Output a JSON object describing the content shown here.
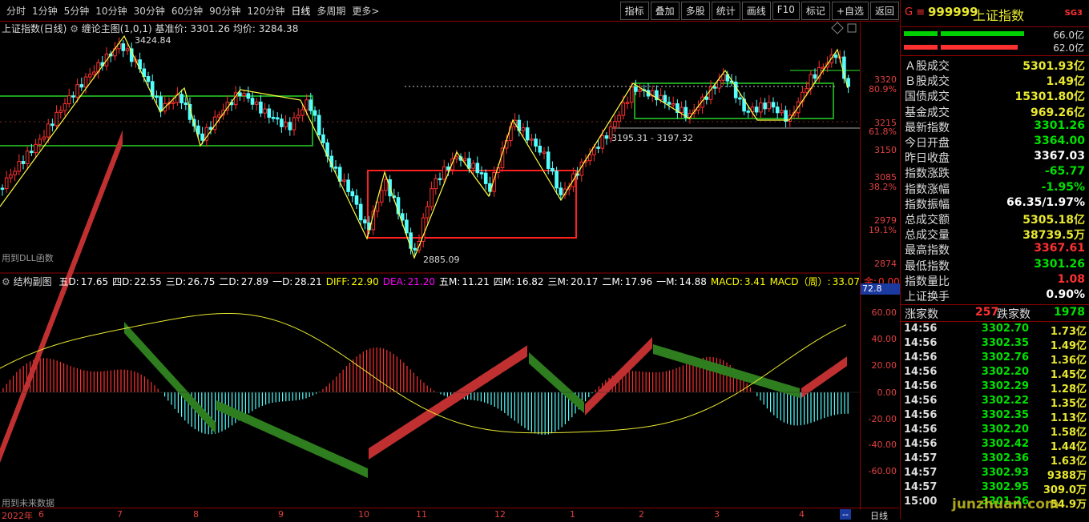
{
  "toolbar": {
    "periods": [
      "分时",
      "1分钟",
      "5分钟",
      "10分钟",
      "30分钟",
      "60分钟",
      "90分钟",
      "120分钟",
      "日线",
      "多周期",
      "更多>"
    ],
    "active_period": "日线",
    "tools": [
      "指标",
      "叠加",
      "多股",
      "统计",
      "画线",
      "F10",
      "标记",
      "+自选",
      "返回"
    ]
  },
  "main_chart": {
    "title": "上证指数(日线)",
    "indicator": "缠论主图(1,0,1)",
    "base_price_label": "基准价: 3301.26",
    "avg_price_label": "均价: 3284.38",
    "high_label": "3424.84",
    "low_label": "2885.09",
    "range_label": "3195.31 - 3197.32",
    "footnote": "用到DLL函数",
    "price_ticks": [
      "3320",
      "3215",
      "3150",
      "3085",
      "2979",
      "2874"
    ],
    "pct_ticks": [
      "80.9%",
      "61.8%",
      "38.2%",
      "19.1%"
    ]
  },
  "sub_chart": {
    "title": "结构副图",
    "values": [
      {
        "label": "五D:",
        "value": "17.65",
        "color": "#ffffff"
      },
      {
        "label": "四D:",
        "value": "22.55",
        "color": "#ffffff"
      },
      {
        "label": "三D:",
        "value": "26.75",
        "color": "#ffffff"
      },
      {
        "label": "二D:",
        "value": "27.89",
        "color": "#ffffff"
      },
      {
        "label": "一D:",
        "value": "28.21",
        "color": "#ffffff"
      },
      {
        "label": "DIFF:",
        "value": "22.90",
        "color": "#ffff00"
      },
      {
        "label": "DEA:",
        "value": "21.20",
        "color": "#ff00ff"
      },
      {
        "label": "五M:",
        "value": "11.21",
        "color": "#ffffff"
      },
      {
        "label": "四M:",
        "value": "16.82",
        "color": "#ffffff"
      },
      {
        "label": "三M:",
        "value": "20.17",
        "color": "#ffffff"
      },
      {
        "label": "二M:",
        "value": "17.96",
        "color": "#ffffff"
      },
      {
        "label": "一M:",
        "value": "14.88",
        "color": "#ffffff"
      },
      {
        "label": "MACD:",
        "value": "3.41",
        "color": "#ffff00"
      },
      {
        "label": "MACD（周）:",
        "value": "33.07",
        "color": "#ffff00"
      },
      {
        "label": "金:",
        "value": "0.00",
        "color": "#ff3030"
      },
      {
        "label": "木",
        "value": "",
        "color": "#00ff00"
      }
    ],
    "ticks": [
      "60.00",
      "40.00",
      "20.00",
      "0.00",
      "-20.00",
      "-40.00",
      "-60.00"
    ],
    "marker_value": "72.8",
    "footnote": "用到未来数据"
  },
  "x_axis": {
    "labels": [
      "2022年",
      "6",
      "7",
      "8",
      "9",
      "10",
      "11",
      "12",
      "1",
      "2",
      "3",
      "4"
    ],
    "period_label": "日线"
  },
  "quote_panel": {
    "code_prefix": "G ≡",
    "code": "999999",
    "name": "上证指数",
    "badge": "SG3",
    "bar_values": [
      "66.0亿",
      "62.0亿"
    ],
    "stats": [
      {
        "k": "Ａ股成交",
        "v": "5301.93亿",
        "color": "#e8e830"
      },
      {
        "k": "Ｂ股成交",
        "v": "1.49亿",
        "color": "#e8e830"
      },
      {
        "k": "国债成交",
        "v": "15301.80亿",
        "color": "#e8e830"
      },
      {
        "k": "基金成交",
        "v": "969.26亿",
        "color": "#e8e830"
      },
      {
        "k": "最新指数",
        "v": "3301.26",
        "color": "#00e000"
      },
      {
        "k": "今日开盘",
        "v": "3364.00",
        "color": "#00e000"
      },
      {
        "k": "昨日收盘",
        "v": "3367.03",
        "color": "#ffffff"
      },
      {
        "k": "指数涨跌",
        "v": "-65.77",
        "color": "#00e000"
      },
      {
        "k": "指数涨幅",
        "v": "-1.95%",
        "color": "#00e000"
      },
      {
        "k": "指数振幅",
        "v": "66.35/1.97%",
        "color": "#ffffff"
      },
      {
        "k": "总成交额",
        "v": "5305.18亿",
        "color": "#e8e830"
      },
      {
        "k": "总成交量",
        "v": "38739.5万",
        "color": "#e8e830"
      },
      {
        "k": "最高指数",
        "v": "3367.61",
        "color": "#ff3030"
      },
      {
        "k": "最低指数",
        "v": "3301.26",
        "color": "#00e000"
      },
      {
        "k": "指数量比",
        "v": "1.08",
        "color": "#ff3030"
      },
      {
        "k": "上证换手",
        "v": "0.90%",
        "color": "#ffffff"
      }
    ],
    "up_label": "涨家数",
    "up_count": "257",
    "down_label": "跌家数",
    "down_count": "1978",
    "ticks": [
      {
        "t": "14:56",
        "p": "3302.70",
        "v": "1.73亿"
      },
      {
        "t": "14:56",
        "p": "3302.35",
        "v": "1.49亿"
      },
      {
        "t": "14:56",
        "p": "3302.76",
        "v": "1.36亿"
      },
      {
        "t": "14:56",
        "p": "3302.20",
        "v": "1.45亿"
      },
      {
        "t": "14:56",
        "p": "3302.29",
        "v": "1.28亿"
      },
      {
        "t": "14:56",
        "p": "3302.22",
        "v": "1.35亿"
      },
      {
        "t": "14:56",
        "p": "3302.35",
        "v": "1.13亿"
      },
      {
        "t": "14:56",
        "p": "3302.20",
        "v": "1.58亿"
      },
      {
        "t": "14:56",
        "p": "3302.42",
        "v": "1.44亿"
      },
      {
        "t": "14:57",
        "p": "3302.36",
        "v": "1.63亿"
      },
      {
        "t": "14:57",
        "p": "3302.93",
        "v": "9388万"
      },
      {
        "t": "14:57",
        "p": "3302.95",
        "v": "309.0万"
      },
      {
        "t": "15:00",
        "p": "3301.26",
        "v": "54.9万"
      }
    ],
    "watermark": "junzhuan.com"
  },
  "colors": {
    "up": "#ff3030",
    "down": "#00e000",
    "frame": "#8b0000",
    "zs_green": "#1e9e1e",
    "zs_red": "#ff2020"
  }
}
